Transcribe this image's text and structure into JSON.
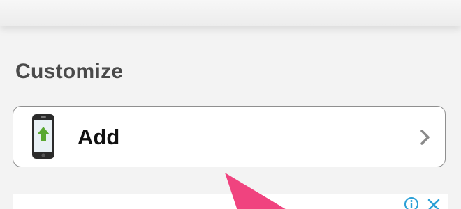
{
  "section": {
    "heading": "Customize"
  },
  "add_row": {
    "label": "Add"
  },
  "icons": {
    "phone": "phone-upload-icon",
    "chevron": "chevron-right-icon",
    "ad_info": "info-icon",
    "ad_close": "close-icon"
  },
  "colors": {
    "background": "#f3f3f3",
    "row_border": "#8f8f8f",
    "upload_arrow": "#5aa832",
    "ad_icons": "#2a9fd6",
    "pointer_arrow": "#f0437f"
  }
}
